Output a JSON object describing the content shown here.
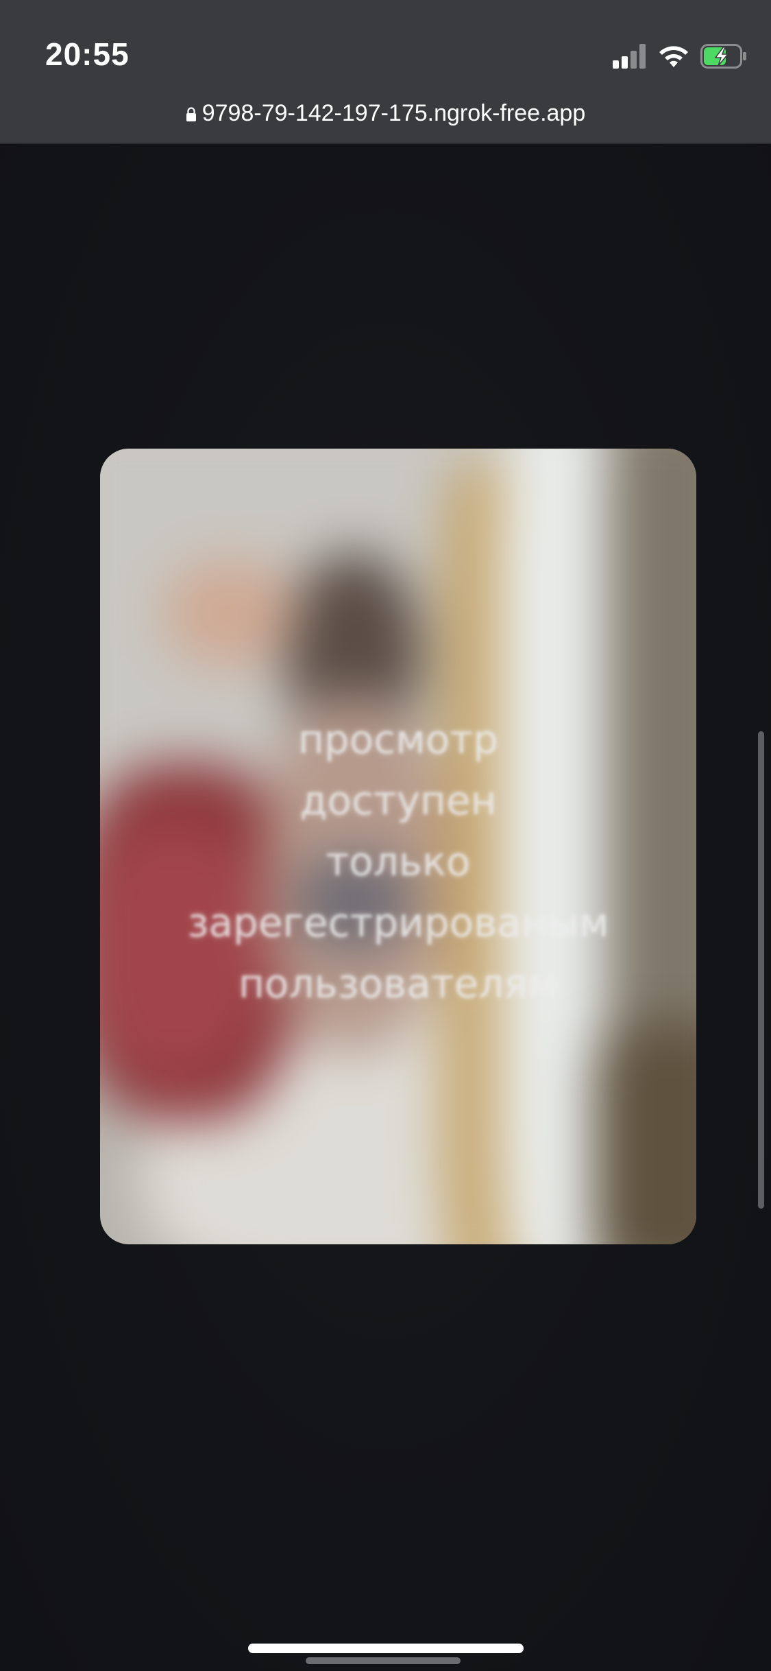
{
  "status_bar": {
    "time": "20:55",
    "signal_icon": "cellular-signal-icon",
    "wifi_icon": "wifi-icon",
    "battery_icon": "battery-charging-icon",
    "battery_level": 0.6,
    "battery_color": "#4cd964"
  },
  "browser": {
    "lock_icon": "lock-icon",
    "url": "9798-79-142-197-175.ngrok-free.app"
  },
  "media": {
    "overlay_lines": [
      "просмотр",
      "доступен",
      "только",
      "зарегестрированым",
      "пользователям"
    ]
  },
  "colors": {
    "background": "#121316",
    "status_bar_bg": "#393b3e"
  }
}
